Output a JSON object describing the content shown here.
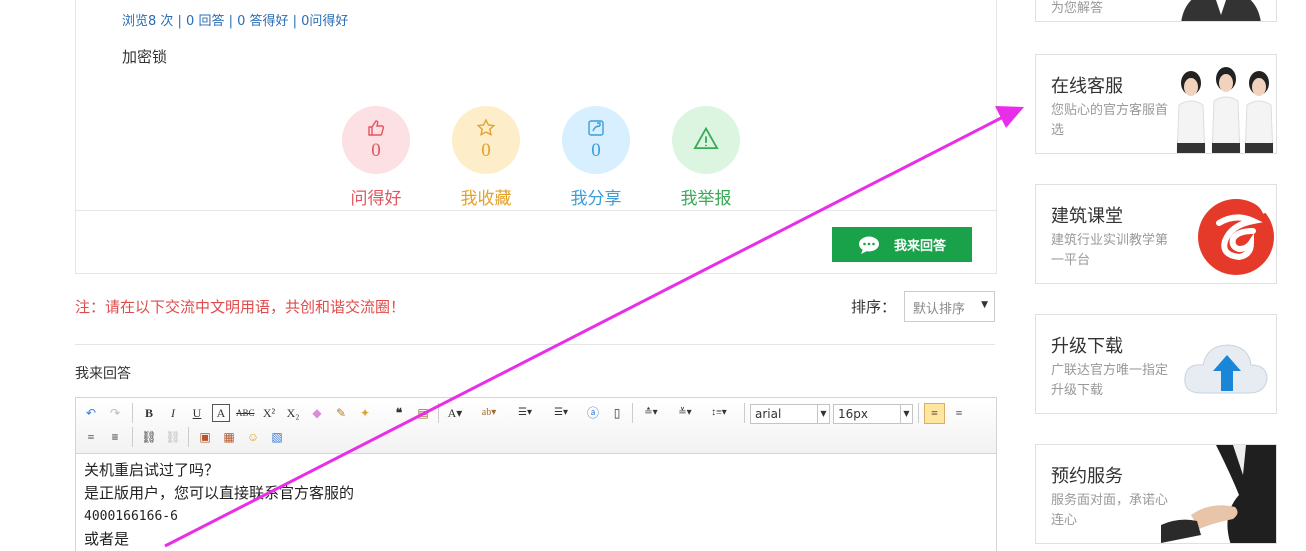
{
  "question": {
    "stats": "浏览8 次 | 0 回答 | 0 答得好 | 0问得好",
    "title": "加密锁"
  },
  "actions": [
    {
      "count": "0",
      "label": "问得好",
      "icon": "thumbs-up-icon"
    },
    {
      "count": "0",
      "label": "我收藏",
      "icon": "star-icon"
    },
    {
      "count": "0",
      "label": "我分享",
      "icon": "share-icon"
    },
    {
      "count": "",
      "label": "我举报",
      "icon": "warning-icon"
    }
  ],
  "answer_button": {
    "label": "我来回答",
    "icon": "chat-bubble-icon"
  },
  "notice": "注：请在以下交流中文明用语，共创和谐交流圈！",
  "sort": {
    "label": "排序：",
    "selected": "默认排序"
  },
  "reply_section": {
    "label": "我来回答"
  },
  "editor": {
    "font_family": "arial",
    "font_size": "16px",
    "lines": [
      "关机重启试过了吗？",
      "是正版用户，您可以直接联系官方客服的",
      "4000166166-6",
      "或者是"
    ]
  },
  "sidebar": [
    {
      "title": "",
      "desc": "为您解答"
    },
    {
      "title": "在线客服",
      "desc": "您贴心的官方客服首选"
    },
    {
      "title": "建筑课堂",
      "desc": "建筑行业实训教学第一平台"
    },
    {
      "title": "升级下载",
      "desc": "广联达官方唯一指定升级下载"
    },
    {
      "title": "预约服务",
      "desc": "服务面对面，承诺心连心"
    }
  ],
  "colors": {
    "primary_green": "#1aa24b",
    "notice_red": "#e04b4b",
    "link_blue": "#2a6db4",
    "annotation_magenta": "#e82ee8"
  }
}
